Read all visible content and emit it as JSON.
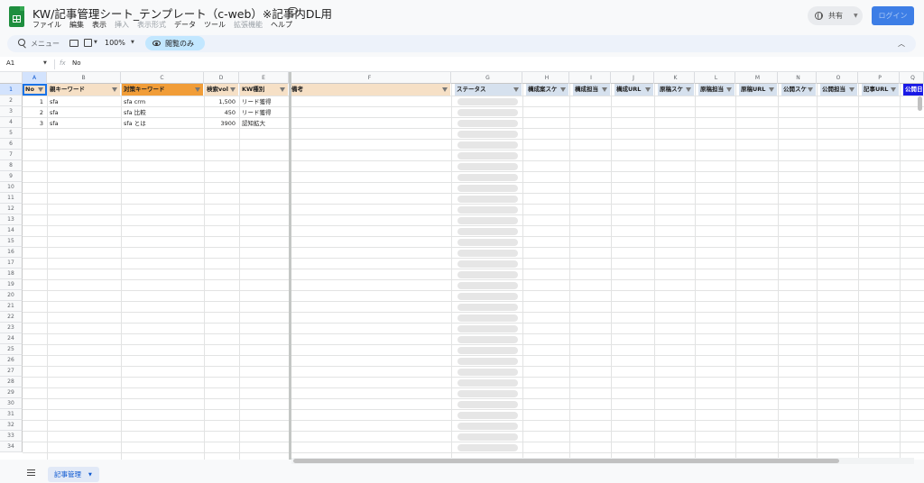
{
  "app": {
    "doc_title": "KW/記事管理シート_テンプレート（c-web）※記事内DL用",
    "menus": [
      {
        "label": "ファイル",
        "enabled": true
      },
      {
        "label": "編集",
        "enabled": true
      },
      {
        "label": "表示",
        "enabled": true
      },
      {
        "label": "挿入",
        "enabled": false
      },
      {
        "label": "表示形式",
        "enabled": false
      },
      {
        "label": "データ",
        "enabled": true
      },
      {
        "label": "ツール",
        "enabled": true
      },
      {
        "label": "拡張機能",
        "enabled": false
      },
      {
        "label": "ヘルプ",
        "enabled": true
      }
    ],
    "share_label": "共有",
    "login_label": "ログイン"
  },
  "toolbar": {
    "menu_search_label": "メニュー",
    "zoom": "100%",
    "view_only_label": "閲覧のみ"
  },
  "formula_bar": {
    "cell_ref": "A1",
    "value": "No"
  },
  "sheet": {
    "column_letters": [
      "A",
      "B",
      "C",
      "D",
      "E",
      "F",
      "G",
      "H",
      "I",
      "J",
      "K",
      "L",
      "M",
      "N",
      "O",
      "P",
      "Q"
    ],
    "header_labels": [
      "No",
      "親キーワード",
      "対策キーワード",
      "検索vol",
      "KW種別",
      "備考",
      "ステータス",
      "構成案スケ",
      "構成担当",
      "構成URL",
      "原稿スケ",
      "原稿担当",
      "原稿URL",
      "公開スケ",
      "公開担当",
      "記事URL",
      "公開日"
    ],
    "rows": [
      {
        "no": "1",
        "parent_kw": "sfa",
        "target_kw": "sfa crm",
        "volume": "1,500",
        "kw_type": "リード獲得"
      },
      {
        "no": "2",
        "parent_kw": "sfa",
        "target_kw": "sfa 比較",
        "volume": "450",
        "kw_type": "リード獲得"
      },
      {
        "no": "3",
        "parent_kw": "sfa",
        "target_kw": "sfa とは",
        "volume": "3900",
        "kw_type": "認知拡大"
      }
    ],
    "row_numbers": [
      "1",
      "2",
      "3",
      "4",
      "5",
      "6",
      "7",
      "8",
      "9",
      "10",
      "11",
      "12",
      "13",
      "14",
      "15",
      "16",
      "17",
      "18",
      "19",
      "20",
      "21",
      "22",
      "23",
      "24",
      "25",
      "26",
      "27",
      "28",
      "29",
      "30",
      "31",
      "32",
      "33",
      "34"
    ],
    "header_colors": {
      "default": "#f6e0c6",
      "target_kw": "#f19d38",
      "status": "#d6e1ee",
      "published": "#1a1ae6"
    }
  },
  "sheet_tabs": [
    {
      "label": "記事管理"
    }
  ],
  "icons": [
    "sheets-logo-icon",
    "cloud-icon",
    "globe-icon",
    "search-icon",
    "print-icon",
    "paint-format-icon",
    "eye-icon",
    "chevron-up-icon",
    "fx-icon",
    "all-sheets-icon"
  ]
}
